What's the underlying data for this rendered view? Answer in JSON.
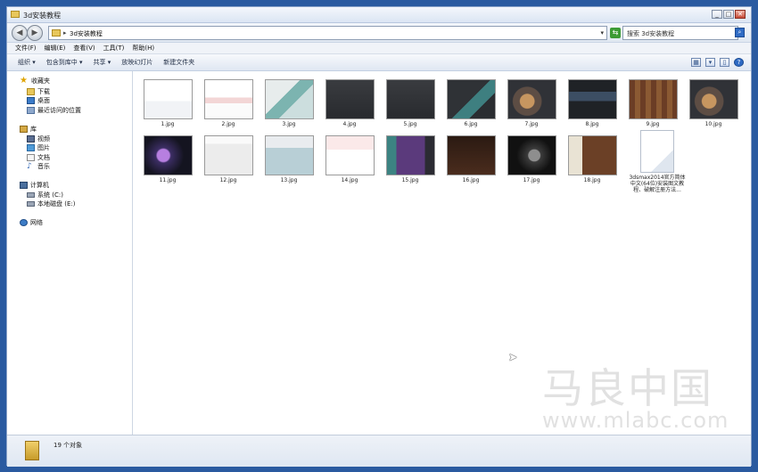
{
  "window": {
    "title": "3d安装教程"
  },
  "address": {
    "separator": "▸",
    "path": "3d安装教程",
    "search_placeholder": "搜索 3d安装教程"
  },
  "menubar": [
    {
      "label": "文件(F)"
    },
    {
      "label": "编辑(E)"
    },
    {
      "label": "查看(V)"
    },
    {
      "label": "工具(T)"
    },
    {
      "label": "帮助(H)"
    }
  ],
  "toolbar": [
    {
      "label": "组织 ▾"
    },
    {
      "label": "包含到库中 ▾"
    },
    {
      "label": "共享 ▾"
    },
    {
      "label": "放映幻灯片"
    },
    {
      "label": "新建文件夹"
    }
  ],
  "navpane": {
    "favorites": "收藏夹",
    "downloads": "下载",
    "desktop": "桌面",
    "recent": "最近访问的位置",
    "libraries": "库",
    "videos": "视频",
    "pictures": "图片",
    "documents": "文档",
    "music": "音乐",
    "computer": "计算机",
    "drive_c": "系统 (C:)",
    "drive_e": "本地磁盘 (E:)",
    "network": "网络"
  },
  "files": [
    {
      "name": "1.jpg"
    },
    {
      "name": "2.jpg"
    },
    {
      "name": "3.jpg"
    },
    {
      "name": "4.jpg"
    },
    {
      "name": "5.jpg"
    },
    {
      "name": "6.jpg"
    },
    {
      "name": "7.jpg"
    },
    {
      "name": "8.jpg"
    },
    {
      "name": "9.jpg"
    },
    {
      "name": "10.jpg"
    },
    {
      "name": "11.jpg"
    },
    {
      "name": "12.jpg"
    },
    {
      "name": "13.jpg"
    },
    {
      "name": "14.jpg"
    },
    {
      "name": "15.jpg"
    },
    {
      "name": "16.jpg"
    },
    {
      "name": "17.jpg"
    },
    {
      "name": "18.jpg"
    },
    {
      "name": "3dsmax2014官方简体中文(64位)安装图文教程、破解注册方法..."
    }
  ],
  "status": {
    "count": "19 个对象"
  },
  "watermark": {
    "cn": "马良中国",
    "url": "www.mlabc.com"
  }
}
